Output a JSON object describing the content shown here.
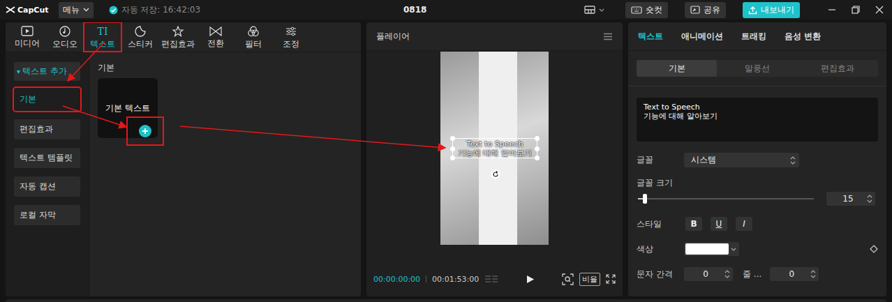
{
  "app": {
    "logo": "CapCut",
    "menu": "메뉴",
    "autosave": "자동 저장: 16:42:03",
    "project": "0818"
  },
  "toolbar": {
    "shortcut": "숏컷",
    "share": "공유",
    "export": "내보내기"
  },
  "media_tabs": [
    {
      "label": "미디어",
      "kind": "media",
      "glyph": "",
      "selected": false,
      "highlighted": false
    },
    {
      "label": "오디오",
      "kind": "audio",
      "glyph": "",
      "selected": false,
      "highlighted": false
    },
    {
      "label": "텍스트",
      "kind": "text",
      "glyph": "TI",
      "selected": true,
      "highlighted": true
    },
    {
      "label": "스티커",
      "kind": "sticker",
      "glyph": "",
      "selected": false,
      "highlighted": false
    },
    {
      "label": "편집효과",
      "kind": "effects",
      "glyph": "",
      "selected": false,
      "highlighted": false
    },
    {
      "label": "전환",
      "kind": "transition",
      "glyph": "",
      "selected": false,
      "highlighted": false
    },
    {
      "label": "필터",
      "kind": "filter",
      "glyph": "",
      "selected": false,
      "highlighted": false
    },
    {
      "label": "조정",
      "kind": "adjust",
      "glyph": "",
      "selected": false,
      "highlighted": false
    }
  ],
  "text_sidebar": {
    "header": "텍스트 추가",
    "toggle": "▾",
    "expanded": true,
    "items": [
      {
        "label": "기본",
        "selected": true,
        "highlighted": true
      },
      {
        "label": "편집효과",
        "selected": false,
        "highlighted": false
      },
      {
        "label": "텍스트 템플릿",
        "selected": false,
        "highlighted": false
      },
      {
        "label": "자동 캡션",
        "selected": false,
        "highlighted": false
      },
      {
        "label": "로컬 자막",
        "selected": false,
        "highlighted": false
      }
    ]
  },
  "library": {
    "section": "기본",
    "cards": [
      {
        "label": "기본 텍스트",
        "highlighted": true
      }
    ]
  },
  "player": {
    "title": "플레이어",
    "current_time": "00:00:00:00",
    "duration": "00:01:53:00",
    "ratio": "비율",
    "overlay_selected": true
  },
  "inspector": {
    "tabs": [
      {
        "label": "텍스트",
        "selected": true
      },
      {
        "label": "애니메이션",
        "selected": false
      },
      {
        "label": "트래킹",
        "selected": false
      },
      {
        "label": "음성 변환",
        "selected": false
      }
    ],
    "subtabs": [
      {
        "label": "기본",
        "selected": true
      },
      {
        "label": "말풍선",
        "selected": false
      },
      {
        "label": "편집효과",
        "selected": false
      }
    ],
    "text_content": "Text to Speech\n기능에 대해 알아보기",
    "font": {
      "label": "글꼴",
      "value": "시스템"
    },
    "font_size": {
      "label": "글꼴 크기",
      "level": 0.04,
      "value": "15"
    },
    "style": {
      "label": "스타일",
      "buttons": [
        {
          "label": "B",
          "kind": "bold"
        },
        {
          "label": "U",
          "kind": "underline"
        },
        {
          "label": "I",
          "kind": "italic"
        }
      ]
    },
    "color": {
      "label": "색상",
      "value": "#ffffff"
    },
    "spacing": {
      "label": "문자 간격",
      "value": "0"
    },
    "line": {
      "label": "줄 ...",
      "value": "0"
    }
  },
  "annotation": {
    "color": "#e3181b"
  }
}
